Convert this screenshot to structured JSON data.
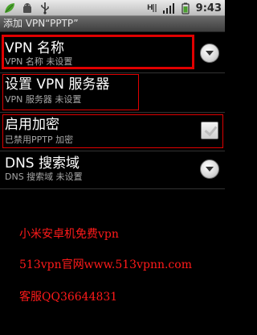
{
  "status_bar": {
    "time": "9:43",
    "icons": [
      "leaf-icon",
      "android-icon",
      "usb-icon",
      "network-h-icon",
      "signal-icon",
      "battery-icon"
    ]
  },
  "title_bar": {
    "title": "添加 VPN“PPTP”"
  },
  "prefs": [
    {
      "title": "VPN 名称",
      "summary": "VPN 名称 未设置",
      "control": "dropdown"
    },
    {
      "title": "设置 VPN 服务器",
      "summary": "VPN 服务器 未设置",
      "control": "none"
    },
    {
      "title": "启用加密",
      "summary": "已禁用PPTP 加密",
      "control": "checkbox"
    },
    {
      "title": "DNS 搜索域",
      "summary": "DNS 搜索域 未设置",
      "control": "dropdown"
    }
  ],
  "overlay_text": {
    "line1": "小米安卓机免费vpn",
    "line2": "513vpn官网www.513vpnn.com",
    "line3": "客服QQ36644831"
  },
  "colors": {
    "highlight_red": "#e00000",
    "overlay_text_red": "#ff1a1a"
  }
}
